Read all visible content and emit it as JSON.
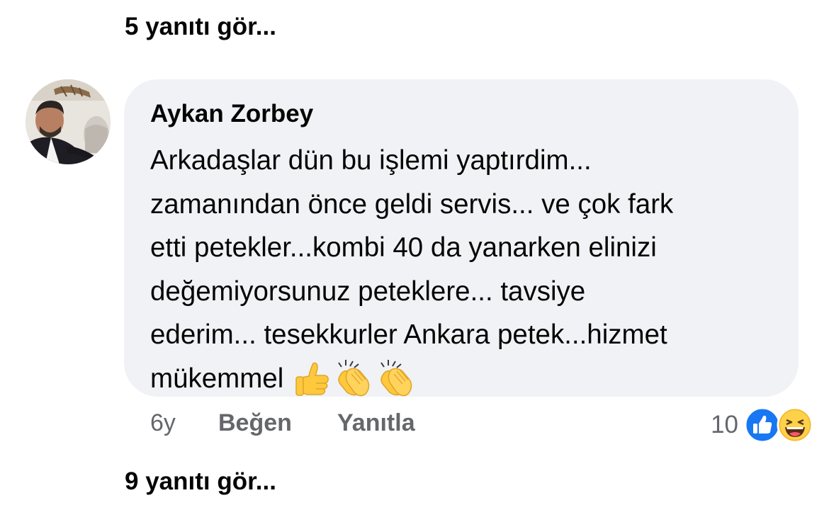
{
  "replies_top": {
    "label": "5 yanıtı gör..."
  },
  "comment": {
    "author": "Aykan Zorbey",
    "lines": [
      "Arkadaşlar dün bu işlemi yaptırdim...",
      "zamanından önce geldi servis... ve çok fark",
      "etti petekler...kombi 40 da yanarken elinizi",
      "değemiyorsunuz peteklere... tavsiye",
      "ederim... tesekkurler Ankara petek...hizmet",
      "mükemmel"
    ],
    "emojis": [
      "thumbs-up-icon",
      "clapping-hands-icon",
      "clapping-hands-icon"
    ],
    "time": "6y",
    "like_label": "Beğen",
    "reply_label": "Yanıtla",
    "reaction_count": "10",
    "reactions": [
      "like-reaction-icon",
      "haha-reaction-icon"
    ]
  },
  "replies_bottom": {
    "label": "9 yanıtı gör..."
  },
  "colors": {
    "bubble_bg": "#f0f2f5",
    "secondary_text": "#65676b",
    "like_blue": "#1877f2",
    "emoji_yellow": "#ffc83d"
  }
}
